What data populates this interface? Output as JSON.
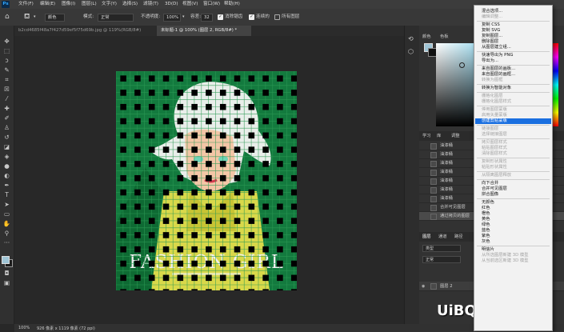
{
  "menubar": {
    "logo": "Ps",
    "items": [
      "文件(F)",
      "编辑(E)",
      "图像(I)",
      "图层(L)",
      "文字(Y)",
      "选择(S)",
      "滤镜(T)",
      "3D(D)",
      "视图(V)",
      "窗口(W)",
      "帮助(H)"
    ]
  },
  "options": {
    "mode_value": "颜色",
    "mode_label": "模式:",
    "blend_value": "正常",
    "opacity_label": "不透明度:",
    "opacity_value": "100%",
    "fill_label": "容差:",
    "fill_value": "32",
    "antialias_label": "消除锯齿",
    "contiguous_label": "连续的",
    "all_layers_label": "所有图层"
  },
  "tabs": [
    {
      "label": "b2cd4685f48a7f427d59ef5f75d69b.jpg @ 119%(RGB/8#)",
      "active": false
    },
    {
      "label": "未标题-1 @ 100% (图层 2, RGB/8#) *",
      "active": true
    }
  ],
  "artwork": {
    "title": "FASHION GIRL"
  },
  "status": {
    "zoom": "100%",
    "size": "926 像素 x 1119 像素 (72 ppi)"
  },
  "color_panel": {
    "tabs": [
      "颜色",
      "色板"
    ]
  },
  "history_panel": {
    "tabs": [
      "学习",
      "库",
      "调整"
    ],
    "items": [
      "油漆桶",
      "油漆桶",
      "油漆桶",
      "油漆桶",
      "油漆桶",
      "油漆桶",
      "油漆桶",
      "合并可见图层",
      "通过拷贝的图层"
    ]
  },
  "layers_panel": {
    "tabs": [
      "图层",
      "通道",
      "路径"
    ],
    "filter_value": "类型",
    "blend_value": "正常",
    "layers": [
      {
        "name": "图层 2"
      }
    ]
  },
  "watermark": {
    "text": "UiBQ.CoM"
  },
  "context_menu": {
    "items": [
      {
        "label": "混合选项...",
        "disabled": false,
        "highlight": false
      },
      {
        "label": "编辑调整...",
        "disabled": true,
        "highlight": false
      },
      {
        "sep": true
      },
      {
        "label": "复制 CSS",
        "disabled": false,
        "highlight": false
      },
      {
        "label": "复制 SVG",
        "disabled": false,
        "highlight": false
      },
      {
        "label": "复制图层...",
        "disabled": false,
        "highlight": false
      },
      {
        "label": "删除图层",
        "disabled": false,
        "highlight": false
      },
      {
        "label": "从图层建立组...",
        "disabled": false,
        "highlight": false
      },
      {
        "sep": true
      },
      {
        "label": "快速导出为 PNG",
        "disabled": false,
        "highlight": false
      },
      {
        "label": "导出为...",
        "disabled": false,
        "highlight": false
      },
      {
        "sep": true
      },
      {
        "label": "来自图层的画板...",
        "disabled": false,
        "highlight": false
      },
      {
        "label": "来自图层的画框...",
        "disabled": false,
        "highlight": false
      },
      {
        "label": "转换为图框",
        "disabled": true,
        "highlight": false
      },
      {
        "sep": true
      },
      {
        "label": "转换为智能对象",
        "disabled": false,
        "highlight": false
      },
      {
        "sep": true
      },
      {
        "label": "栅格化图层",
        "disabled": true,
        "highlight": false
      },
      {
        "label": "栅格化图层样式",
        "disabled": true,
        "highlight": false
      },
      {
        "sep": true
      },
      {
        "label": "停用图层蒙版",
        "disabled": true,
        "highlight": false
      },
      {
        "label": "启用矢量蒙版",
        "disabled": true,
        "highlight": false
      },
      {
        "label": "创建剪贴蒙版",
        "disabled": false,
        "highlight": true
      },
      {
        "sep": true
      },
      {
        "label": "链接图层",
        "disabled": true,
        "highlight": false
      },
      {
        "label": "选择链接图层",
        "disabled": true,
        "highlight": false
      },
      {
        "sep": true
      },
      {
        "label": "拷贝图层样式",
        "disabled": true,
        "highlight": false
      },
      {
        "label": "粘贴图层样式",
        "disabled": true,
        "highlight": false
      },
      {
        "label": "清除图层样式",
        "disabled": true,
        "highlight": false
      },
      {
        "sep": true
      },
      {
        "label": "复制形状属性",
        "disabled": true,
        "highlight": false
      },
      {
        "label": "粘贴形状属性",
        "disabled": true,
        "highlight": false
      },
      {
        "sep": true
      },
      {
        "label": "从隔离图层释放",
        "disabled": true,
        "highlight": false
      },
      {
        "sep": true
      },
      {
        "label": "向下合并",
        "disabled": false,
        "highlight": false
      },
      {
        "label": "合并可见图层",
        "disabled": false,
        "highlight": false
      },
      {
        "label": "拼合图像",
        "disabled": false,
        "highlight": false
      },
      {
        "sep": true
      },
      {
        "label": "无颜色",
        "disabled": false,
        "highlight": false
      },
      {
        "label": "红色",
        "disabled": false,
        "highlight": false
      },
      {
        "label": "橙色",
        "disabled": false,
        "highlight": false
      },
      {
        "label": "黄色",
        "disabled": false,
        "highlight": false
      },
      {
        "label": "绿色",
        "disabled": false,
        "highlight": false
      },
      {
        "label": "蓝色",
        "disabled": false,
        "highlight": false
      },
      {
        "label": "紫色",
        "disabled": false,
        "highlight": false
      },
      {
        "label": "灰色",
        "disabled": false,
        "highlight": false
      },
      {
        "sep": true
      },
      {
        "label": "明信片",
        "disabled": false,
        "highlight": false
      },
      {
        "label": "从所选图层新建 3D 模型",
        "disabled": true,
        "highlight": false
      },
      {
        "label": "从当前选区新建 3D 模型",
        "disabled": true,
        "highlight": false
      }
    ]
  }
}
